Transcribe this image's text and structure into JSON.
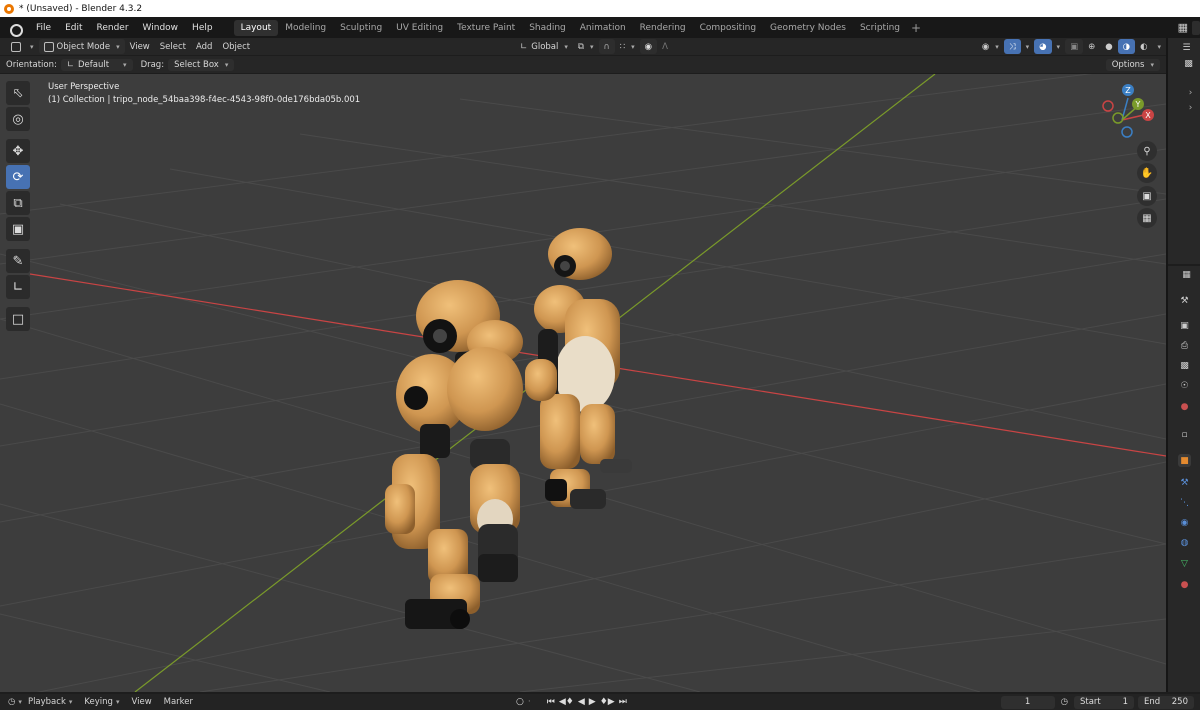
{
  "window": {
    "title": "* (Unsaved) - Blender 4.3.2"
  },
  "menus": [
    "File",
    "Edit",
    "Render",
    "Window",
    "Help"
  ],
  "workspaces": [
    "Layout",
    "Modeling",
    "Sculpting",
    "UV Editing",
    "Texture Paint",
    "Shading",
    "Animation",
    "Rendering",
    "Compositing",
    "Geometry Nodes",
    "Scripting"
  ],
  "active_workspace": "Layout",
  "header": {
    "mode": "Object Mode",
    "menu_view": "View",
    "menu_select": "Select",
    "menu_add": "Add",
    "menu_object": "Object",
    "transform_orientation": "Global"
  },
  "tool_settings": {
    "orientation_label": "Orientation:",
    "orientation_value": "Default",
    "drag_label": "Drag:",
    "drag_value": "Select Box",
    "options": "Options"
  },
  "viewport": {
    "perspective": "User Perspective",
    "collection_info": "(1) Collection | tripo_node_54baa398-f4ec-4543-98f0-0de176bda05b.001"
  },
  "gizmo": {
    "x": "X",
    "y": "Y",
    "z": "Z"
  },
  "timeline": {
    "playback": "Playback",
    "keying": "Keying",
    "view": "View",
    "marker": "Marker",
    "current_frame": "1",
    "start_label": "Start",
    "start_value": "1",
    "end_label": "End",
    "end_value": "250"
  },
  "colors": {
    "accent": "#4772b3",
    "viewport_bg": "#3d3d3d",
    "x_axis": "#c94444",
    "y_axis": "#7a9a2a",
    "robot": "#d8a05a"
  }
}
